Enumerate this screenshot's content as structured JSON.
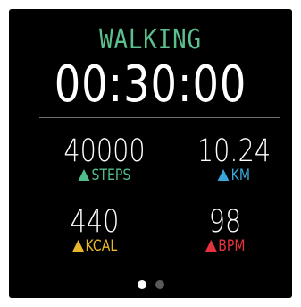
{
  "workout": {
    "title": "WALKING",
    "elapsed": "00:30:00",
    "title_color": "#5dbf8e"
  },
  "stats": [
    {
      "value": "40000",
      "unit": "STEPS",
      "icon": "triangle-icon",
      "color": "#52bd8a"
    },
    {
      "value": "10.24",
      "unit": "KM",
      "icon": "triangle-icon",
      "color": "#3aa6d9"
    },
    {
      "value": "440",
      "unit": "KCAL",
      "icon": "triangle-icon",
      "color": "#e8b52b"
    },
    {
      "value": "98",
      "unit": "BPM",
      "icon": "triangle-icon",
      "color": "#e6323f"
    }
  ],
  "pager": {
    "pages": 2,
    "current_page": 1,
    "active_color": "#ffffff",
    "inactive_color": "#5a5a5a"
  }
}
